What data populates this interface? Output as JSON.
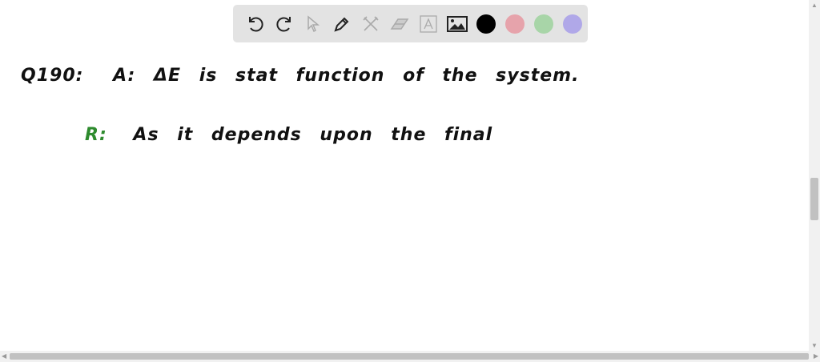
{
  "toolbar": {
    "tools": [
      "undo",
      "redo",
      "select",
      "pen",
      "tools",
      "eraser",
      "text",
      "image"
    ],
    "colors": [
      "#000000",
      "#e6a3ab",
      "#a8d5a8",
      "#b0a8e8"
    ]
  },
  "content": {
    "line1_label": "Q190:",
    "line1_text": "A: ΔE is stat function of the system.",
    "line2_label": "R:",
    "line2_text": "As it depends upon the final",
    "label_color": "#2e8b2e"
  }
}
